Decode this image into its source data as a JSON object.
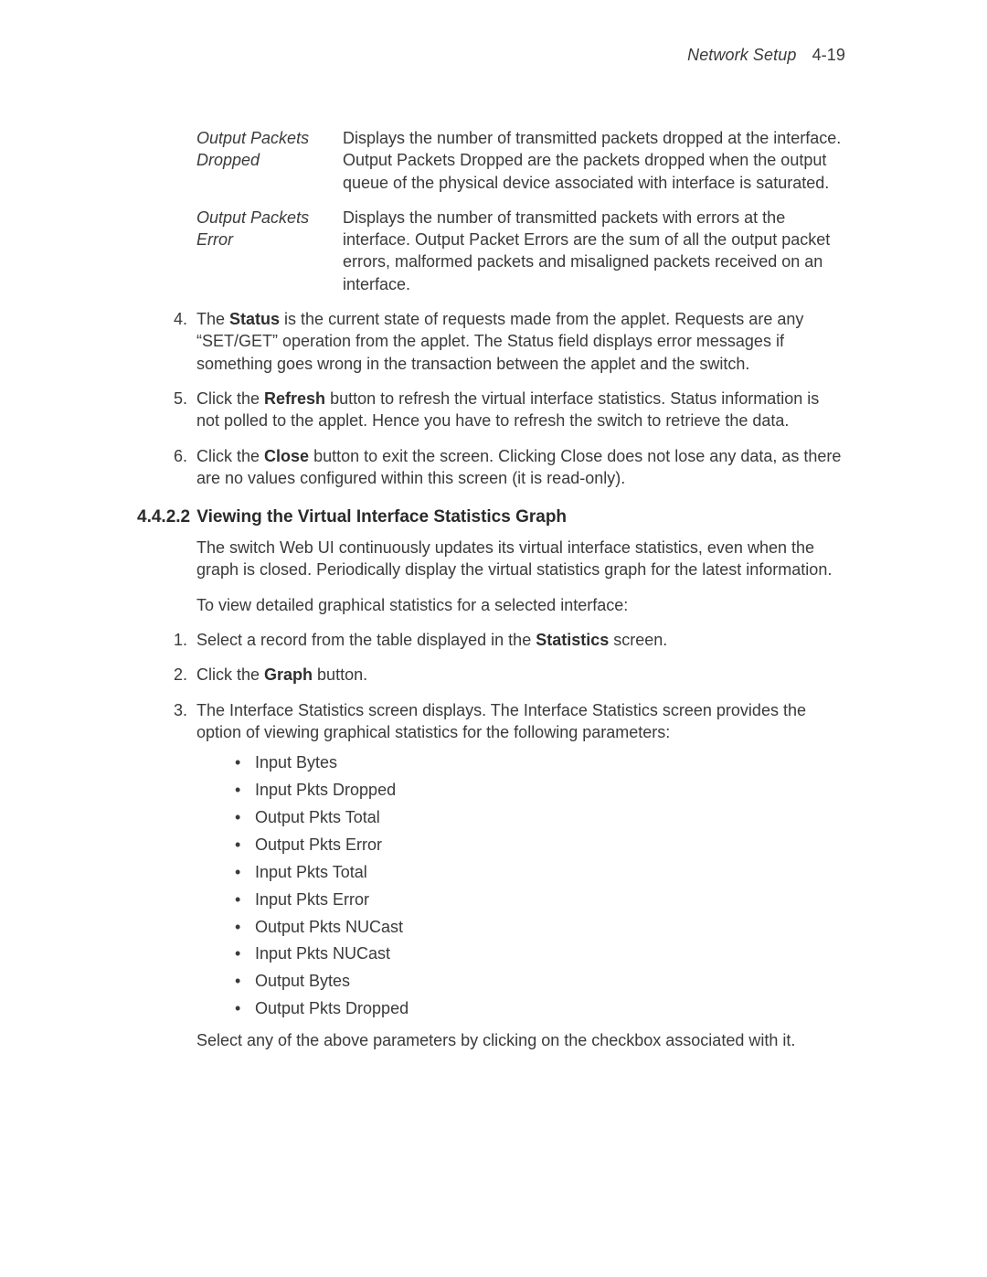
{
  "header": {
    "title": "Network Setup",
    "page_number": "4-19"
  },
  "def_table": [
    {
      "term": "Output Packets Dropped",
      "desc": "Displays the number of transmitted packets dropped at the interface. Output Packets Dropped are the packets dropped when the output queue of the physical device associated with interface is saturated."
    },
    {
      "term": "Output Packets Error",
      "desc": "Displays the number of transmitted packets with errors at the interface. Output Packet Errors are the sum of all the output packet errors, malformed packets and misaligned packets received on an interface."
    }
  ],
  "top_list": [
    {
      "num": "4",
      "pre": "The ",
      "bold": "Status",
      "post": " is the current state of requests made from the applet. Requests are any “SET/GET” operation from the applet. The Status field displays error messages if something goes wrong in the transaction between the applet and the switch."
    },
    {
      "num": "5",
      "pre": "Click the ",
      "bold": "Refresh",
      "post": " button to refresh the virtual interface statistics. Status information is not polled to the applet. Hence you have to refresh the switch to retrieve the data."
    },
    {
      "num": "6",
      "pre": "Click the ",
      "bold": "Close",
      "post": " button to exit the screen. Clicking Close does not lose any data, as there are no values configured within this screen (it is read-only)."
    }
  ],
  "section": {
    "number": "4.4.2.2",
    "title": "Viewing the Virtual Interface Statistics Graph",
    "paras": [
      "The switch Web UI continuously updates its virtual interface statistics, even when the graph is closed. Periodically display the virtual statistics graph for the latest information.",
      "To view detailed graphical statistics for a selected interface:"
    ]
  },
  "sub_list": [
    {
      "num": "1",
      "pre": "Select a record from the table displayed in the ",
      "bold": "Statistics",
      "post": " screen."
    },
    {
      "num": "2",
      "pre": "Click the ",
      "bold": "Graph",
      "post": " button."
    },
    {
      "num": "3",
      "pre": "",
      "bold": "",
      "post": "The Interface Statistics screen displays. The Interface Statistics screen provides the option of viewing graphical statistics for the following parameters:"
    }
  ],
  "bullets": [
    "Input Bytes",
    "Input Pkts Dropped",
    "Output Pkts Total",
    "Output Pkts Error",
    "Input Pkts Total",
    "Input Pkts Error",
    "Output Pkts NUCast",
    "Input Pkts NUCast",
    "Output Bytes",
    "Output Pkts Dropped"
  ],
  "closing_para": "Select any of the above parameters by clicking on the checkbox associated with it."
}
